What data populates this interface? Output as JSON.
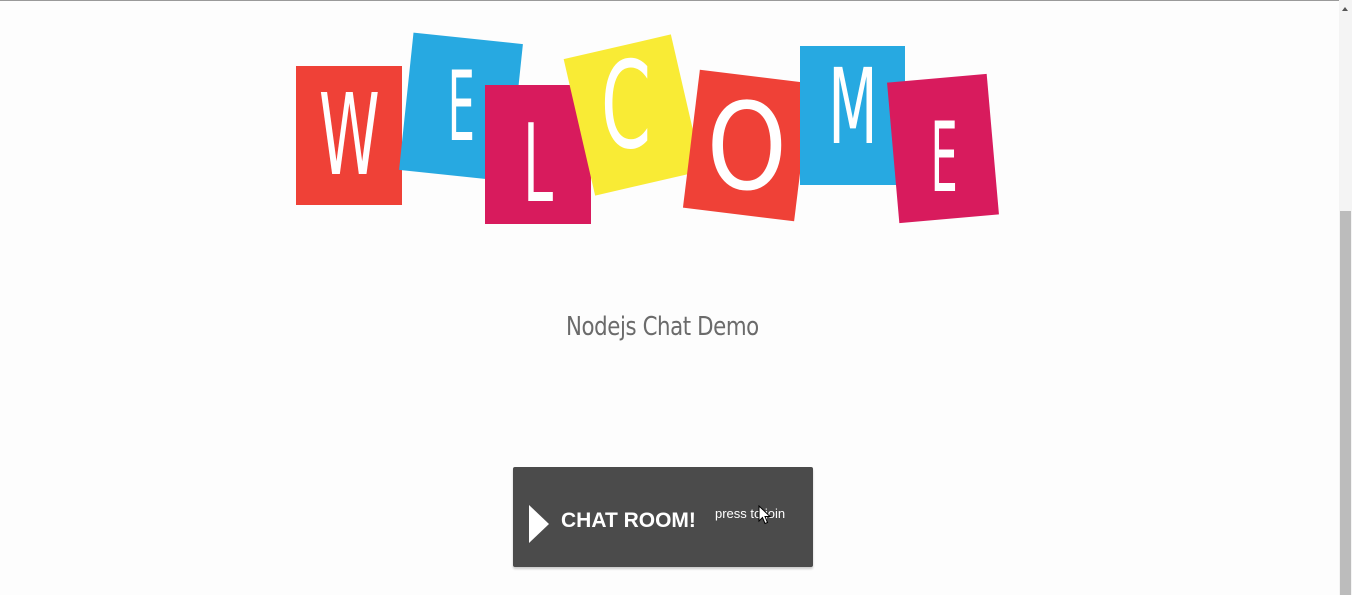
{
  "welcome": {
    "letters": [
      "W",
      "E",
      "L",
      "C",
      "O",
      "M",
      "E"
    ],
    "colors": {
      "red": "#ef4137",
      "blue": "#27a9e1",
      "magenta": "#d81b5d",
      "yellow": "#f9eb35"
    }
  },
  "subtitle": "Nodejs Chat Demo",
  "chat_button": {
    "label": "CHAT ROOM!",
    "sublabel": "press to join",
    "icon": "play-icon",
    "background": "#4b4b4b"
  }
}
